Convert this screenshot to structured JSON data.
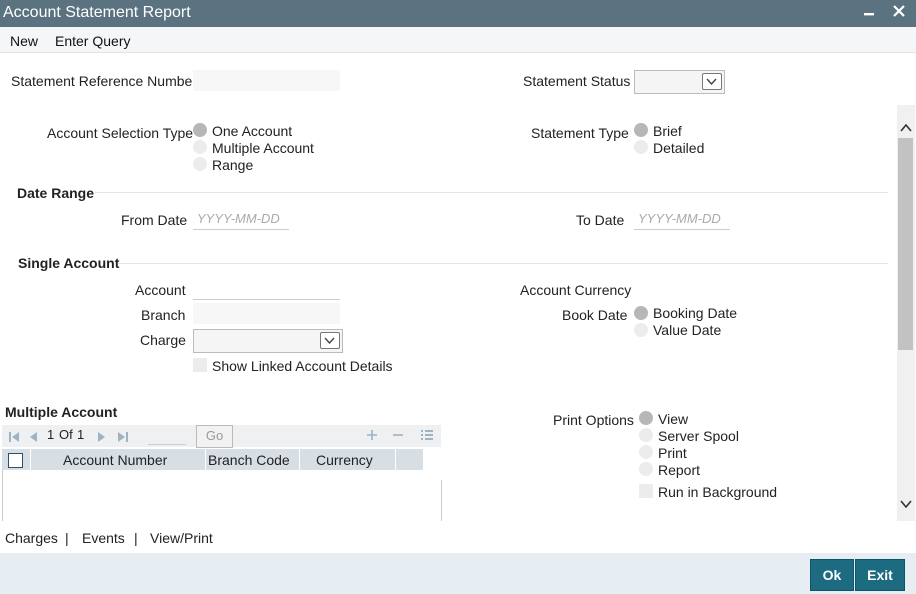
{
  "window": {
    "title": "Account Statement Report"
  },
  "menu": {
    "new": "New",
    "enter_query": "Enter Query"
  },
  "form": {
    "statement_reference_number": {
      "label": "Statement Reference Number",
      "value": ""
    },
    "statement_status": {
      "label": "Statement Status",
      "value": ""
    },
    "account_selection_type": {
      "label": "Account Selection Type",
      "options": [
        "One Account",
        "Multiple Account",
        "Range"
      ],
      "selected": "One Account"
    },
    "statement_type": {
      "label": "Statement Type",
      "options": [
        "Brief",
        "Detailed"
      ],
      "selected": "Brief"
    },
    "date_range": {
      "heading": "Date Range",
      "from_label": "From Date",
      "from_placeholder": "YYYY-MM-DD",
      "to_label": "To Date",
      "to_placeholder": "YYYY-MM-DD"
    },
    "single_account": {
      "heading": "Single Account",
      "account_label": "Account",
      "branch_label": "Branch",
      "charge_label": "Charge",
      "show_linked_label": "Show Linked Account Details",
      "account_currency_label": "Account Currency",
      "book_date_label": "Book Date",
      "book_date_options": [
        "Booking Date",
        "Value Date"
      ],
      "book_date_selected": "Booking Date"
    },
    "multiple_account": {
      "heading": "Multiple Account",
      "pagination": {
        "current": "1",
        "of_label": "Of",
        "total": "1"
      },
      "go_label": "Go",
      "columns": [
        "Account Number",
        "Branch Code",
        "Currency"
      ]
    },
    "print_options": {
      "label": "Print Options",
      "options": [
        "View",
        "Server Spool",
        "Print",
        "Report"
      ],
      "selected": "View",
      "run_in_background_label": "Run in Background"
    }
  },
  "bottom_links": {
    "charges": "Charges",
    "events": "Events",
    "view_print": "View/Print",
    "separator": "|"
  },
  "footer": {
    "ok": "Ok",
    "exit": "Exit"
  },
  "colors": {
    "titlebar": "#5b7280",
    "button": "#1d6b80",
    "footer": "#e6eef3",
    "grid_header": "#d7dfe5"
  }
}
